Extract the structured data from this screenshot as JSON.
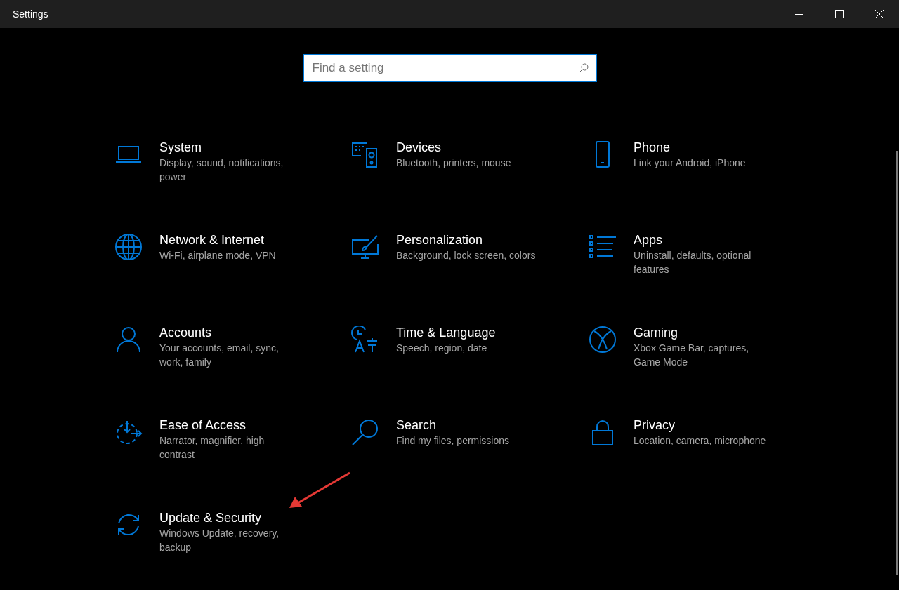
{
  "window": {
    "title": "Settings"
  },
  "search": {
    "placeholder": "Find a setting"
  },
  "tiles": [
    {
      "kind": "laptop",
      "title": "System",
      "description": "Display, sound, notifications, power"
    },
    {
      "kind": "devices",
      "title": "Devices",
      "description": "Bluetooth, printers, mouse"
    },
    {
      "kind": "phone",
      "title": "Phone",
      "description": "Link your Android, iPhone"
    },
    {
      "kind": "globe",
      "title": "Network & Internet",
      "description": "Wi-Fi, airplane mode, VPN"
    },
    {
      "kind": "paint",
      "title": "Personalization",
      "description": "Background, lock screen, colors"
    },
    {
      "kind": "list",
      "title": "Apps",
      "description": "Uninstall, defaults, optional features"
    },
    {
      "kind": "person",
      "title": "Accounts",
      "description": "Your accounts, email, sync, work, family"
    },
    {
      "kind": "time",
      "title": "Time & Language",
      "description": "Speech, region, date"
    },
    {
      "kind": "xbox",
      "title": "Gaming",
      "description": "Xbox Game Bar, captures, Game Mode"
    },
    {
      "kind": "ease",
      "title": "Ease of Access",
      "description": "Narrator, magnifier, high contrast"
    },
    {
      "kind": "search",
      "title": "Search",
      "description": "Find my files, permissions"
    },
    {
      "kind": "lock",
      "title": "Privacy",
      "description": "Location, camera, microphone"
    },
    {
      "kind": "sync",
      "title": "Update & Security",
      "description": "Windows Update, recovery, backup"
    }
  ]
}
